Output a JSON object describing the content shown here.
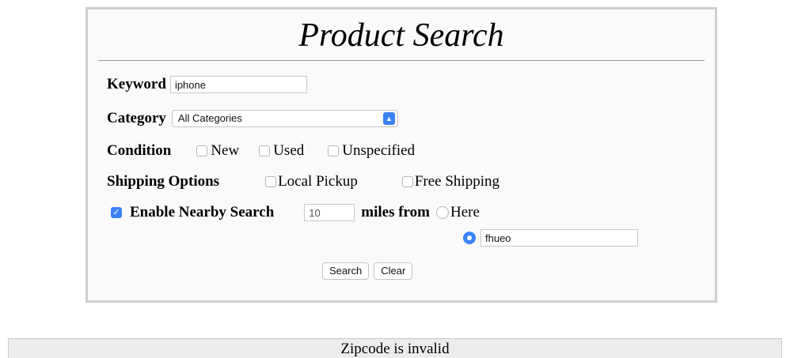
{
  "form": {
    "title": "Product Search",
    "keyword": {
      "label": "Keyword",
      "value": "iphone"
    },
    "category": {
      "label": "Category",
      "selected": "All Categories"
    },
    "condition": {
      "label": "Condition",
      "options": [
        {
          "label": "New",
          "checked": false
        },
        {
          "label": "Used",
          "checked": false
        },
        {
          "label": "Unspecified",
          "checked": false
        }
      ]
    },
    "shipping": {
      "label": "Shipping Options",
      "options": [
        {
          "label": "Local Pickup",
          "checked": false
        },
        {
          "label": "Free Shipping",
          "checked": false
        }
      ]
    },
    "nearby": {
      "label": "Enable Nearby Search",
      "checked": true,
      "distance_value": "10",
      "miles_from_label": "miles from",
      "here_label": "Here",
      "here_selected": false,
      "zip_selected": true,
      "zip_value": "fhueo"
    },
    "buttons": {
      "search_label": "Search",
      "clear_label": "Clear"
    }
  },
  "status": {
    "message": "Zipcode is invalid"
  },
  "colors": {
    "accent": "#3b82f6",
    "panel_border": "#cfcfcf",
    "panel_bg": "#fafafa",
    "status_bg": "#ececec"
  },
  "icons": {
    "select_arrow": "chevron-updown-icon",
    "checkmark": "check-icon"
  }
}
